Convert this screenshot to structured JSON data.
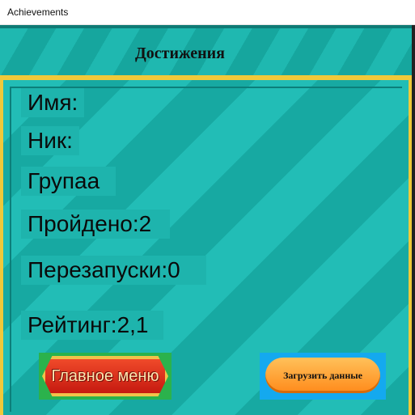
{
  "window": {
    "title": "Achievements"
  },
  "header": {
    "title": "Достижения"
  },
  "profile": {
    "name_label": "Имя:",
    "nick_label": "Ник:",
    "group_label": "Групаа",
    "passed_label": "Пройдено:2",
    "restarts_label": "Перезапуски:0",
    "rating_label": "Рейтинг:2,1"
  },
  "buttons": {
    "main_menu": "Главное меню",
    "load_data": "Загрузить данные"
  }
}
